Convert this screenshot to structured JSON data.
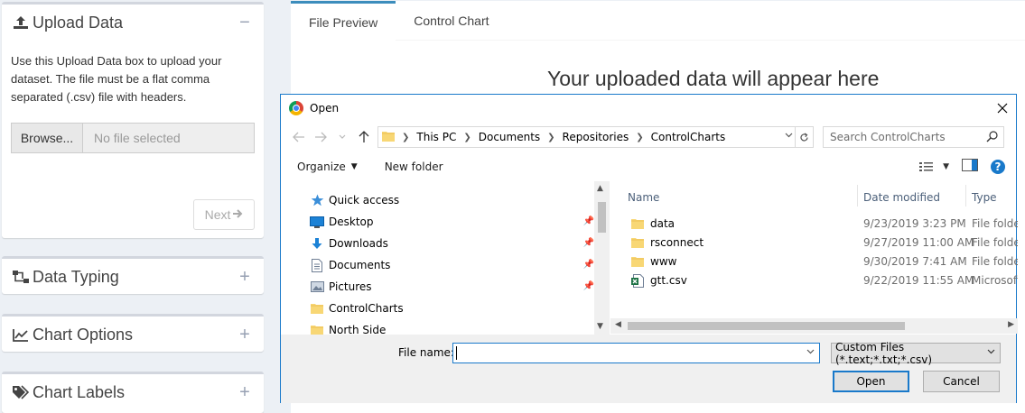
{
  "sidebar": {
    "upload": {
      "title": "Upload Data",
      "tool": "−",
      "description": "Use this Upload Data box to upload your dataset. The file must be a flat comma separated (.csv) file with headers.",
      "browse_label": "Browse...",
      "file_placeholder": "No file selected",
      "next_label": "Next"
    },
    "data_typing": {
      "title": "Data Typing",
      "tool": "+"
    },
    "chart_options": {
      "title": "Chart Options",
      "tool": "+"
    },
    "chart_labels": {
      "title": "Chart Labels",
      "tool": "+"
    }
  },
  "main": {
    "tabs": [
      {
        "label": "File Preview",
        "active": true
      },
      {
        "label": "Control Chart",
        "active": false
      }
    ],
    "placeholder": "Your uploaded data will appear here"
  },
  "dialog": {
    "title": "Open",
    "breadcrumbs": [
      "This PC",
      "Documents",
      "Repositories",
      "ControlCharts"
    ],
    "search_placeholder": "Search ControlCharts",
    "organize_label": "Organize",
    "new_folder_label": "New folder",
    "nav_items": [
      {
        "label": "Quick access",
        "icon": "star-icon",
        "pinned": false
      },
      {
        "label": "Desktop",
        "icon": "desktop-icon",
        "pinned": true
      },
      {
        "label": "Downloads",
        "icon": "download-icon",
        "pinned": true
      },
      {
        "label": "Documents",
        "icon": "document-icon",
        "pinned": true
      },
      {
        "label": "Pictures",
        "icon": "pictures-icon",
        "pinned": true
      },
      {
        "label": "ControlCharts",
        "icon": "folder-icon",
        "pinned": false
      },
      {
        "label": "North Side",
        "icon": "folder-icon",
        "pinned": false
      }
    ],
    "columns": {
      "name": "Name",
      "date_modified": "Date modified",
      "type": "Type"
    },
    "files": [
      {
        "name": "data",
        "date": "9/23/2019 3:23 PM",
        "type": "File folder",
        "icon": "folder-icon"
      },
      {
        "name": "rsconnect",
        "date": "9/27/2019 11:00 AM",
        "type": "File folder",
        "icon": "folder-icon"
      },
      {
        "name": "www",
        "date": "9/30/2019 7:41 AM",
        "type": "File folder",
        "icon": "folder-icon"
      },
      {
        "name": "gtt.csv",
        "date": "9/22/2019 11:55 AM",
        "type": "Microsoft",
        "icon": "excel-file-icon"
      }
    ],
    "filename_label": "File name:",
    "filename_value": "",
    "filter_label": "Custom Files (*.text;*.txt;*.csv)",
    "open_label": "Open",
    "cancel_label": "Cancel"
  },
  "colors": {
    "accent": "#3c8dbc",
    "dialog_border": "#1979ca",
    "folder": "#f8d775"
  }
}
